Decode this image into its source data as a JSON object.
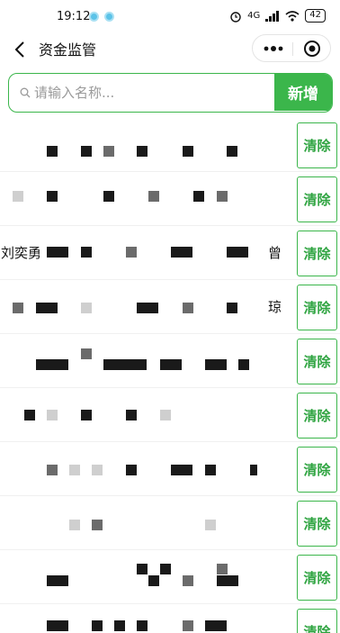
{
  "status_bar": {
    "time": "19:12",
    "network": "4G",
    "battery": "42"
  },
  "nav": {
    "title": "资金监管"
  },
  "search": {
    "placeholder": "请输入名称...",
    "add_label": "新增"
  },
  "list": {
    "clear_label": "清除",
    "rows": [
      {
        "text": "",
        "suffix": ""
      },
      {
        "text": "",
        "suffix": ""
      },
      {
        "text": "刘奕勇",
        "suffix": "曾"
      },
      {
        "text": "",
        "suffix": "琼"
      },
      {
        "text": "",
        "suffix": ""
      },
      {
        "text": "",
        "suffix": ""
      },
      {
        "text": "",
        "suffix": ""
      },
      {
        "text": "",
        "suffix": ""
      },
      {
        "text": "",
        "suffix": ""
      },
      {
        "text": "",
        "suffix": ""
      }
    ]
  },
  "colors": {
    "accent": "#3bb64b",
    "accent_text": "#2fa441",
    "status_dot": "#5cc3e8"
  }
}
